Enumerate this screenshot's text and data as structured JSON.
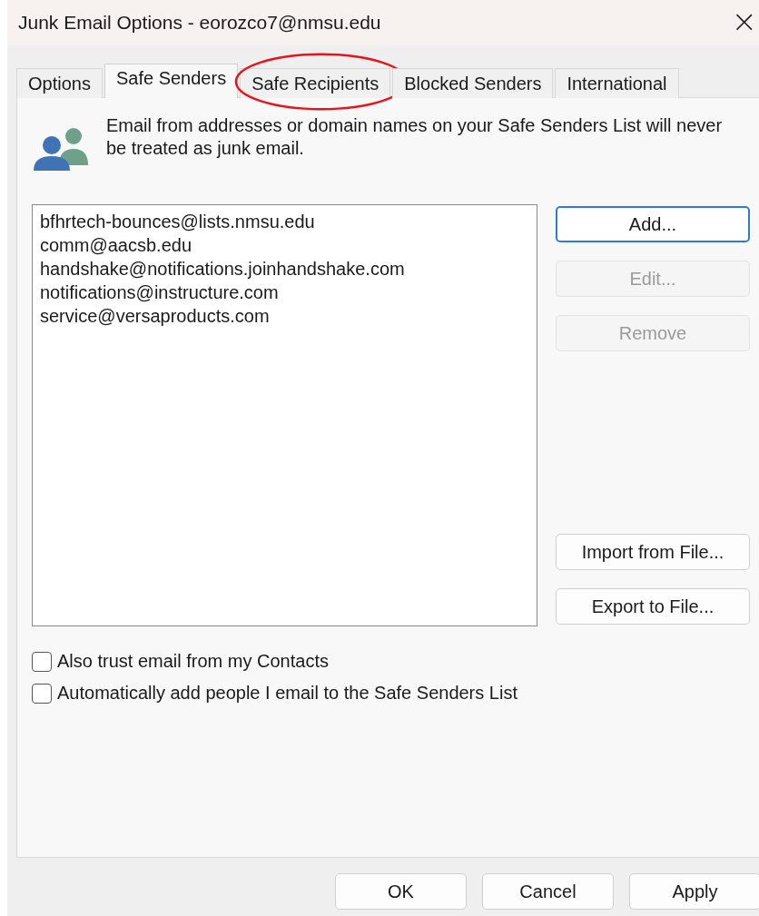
{
  "window": {
    "title": "Junk Email Options - eorozco7@nmsu.edu",
    "close": "×"
  },
  "tabs": [
    {
      "label": "Options",
      "selected": false,
      "circled": false
    },
    {
      "label": "Safe Senders",
      "selected": true,
      "circled": false
    },
    {
      "label": "Safe Recipients",
      "selected": false,
      "circled": true
    },
    {
      "label": "Blocked Senders",
      "selected": false,
      "circled": false
    },
    {
      "label": "International",
      "selected": false,
      "circled": false
    }
  ],
  "description": "Email from addresses or domain names on your Safe Senders List will never be treated as junk email.",
  "list": [
    "bfhrtech-bounces@lists.nmsu.edu",
    "comm@aacsb.edu",
    "handshake@notifications.joinhandshake.com",
    "notifications@instructure.com",
    "service@versaproducts.com"
  ],
  "side_buttons": [
    {
      "label": "Add...",
      "kind": "default",
      "disabled": false
    },
    {
      "label": "Edit...",
      "kind": "normal",
      "disabled": true
    },
    {
      "label": "Remove",
      "kind": "normal",
      "disabled": true
    },
    {
      "label": "Import from File...",
      "kind": "spacer-before",
      "disabled": false
    },
    {
      "label": "Export to File...",
      "kind": "normal",
      "disabled": false
    }
  ],
  "checkboxes": [
    {
      "label": "Also trust email from my Contacts",
      "checked": false
    },
    {
      "label": "Automatically add people I email to the Safe Senders List",
      "checked": false
    }
  ],
  "buttons": [
    "OK",
    "Cancel",
    "Apply"
  ]
}
